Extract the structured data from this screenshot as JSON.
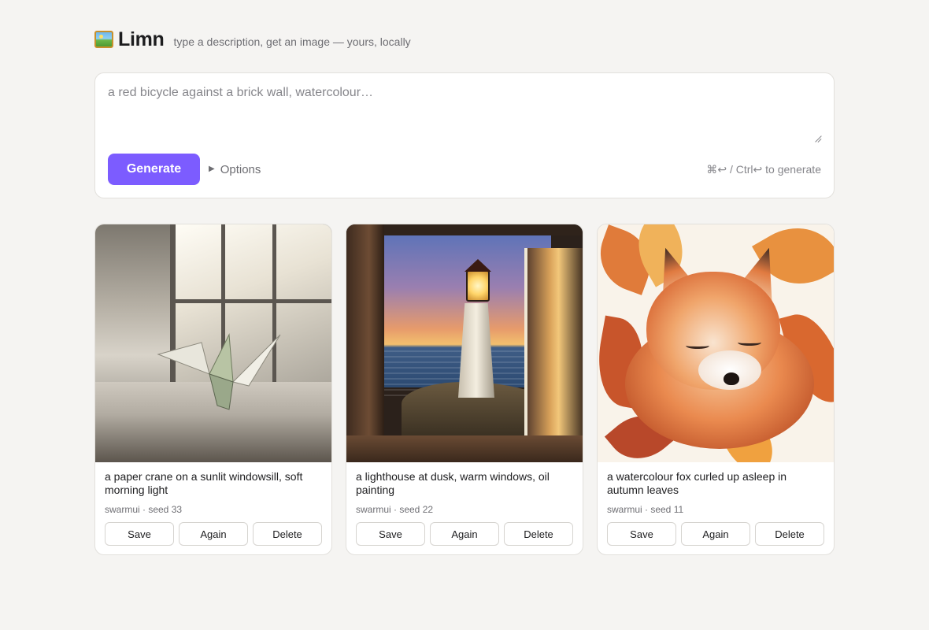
{
  "app": {
    "title": "Limn",
    "tagline": "type a description, get an image — yours, locally"
  },
  "prompt": {
    "placeholder": "a red bicycle against a brick wall, watercolour…",
    "value": "",
    "generate_label": "Generate",
    "options_label": "Options",
    "shortcut_hint": "⌘↩ / Ctrl↩ to generate"
  },
  "gallery": [
    {
      "caption": "a paper crane on a sunlit windowsill, soft morning light",
      "meta": "swarmui · seed 33",
      "image": "paper-crane-windowsill",
      "actions": {
        "save": "Save",
        "again": "Again",
        "delete": "Delete"
      }
    },
    {
      "caption": "a lighthouse at dusk, warm windows, oil painting",
      "meta": "swarmui · seed 22",
      "image": "lighthouse-dusk-window",
      "actions": {
        "save": "Save",
        "again": "Again",
        "delete": "Delete"
      }
    },
    {
      "caption": "a watercolour fox curled up asleep in autumn leaves",
      "meta": "swarmui · seed 11",
      "image": "fox-autumn-leaves",
      "actions": {
        "save": "Save",
        "again": "Again",
        "delete": "Delete"
      }
    }
  ],
  "colors": {
    "accent": "#7c5cff",
    "background": "#f5f4f2",
    "card": "#ffffff",
    "muted_text": "#6e6e73"
  }
}
